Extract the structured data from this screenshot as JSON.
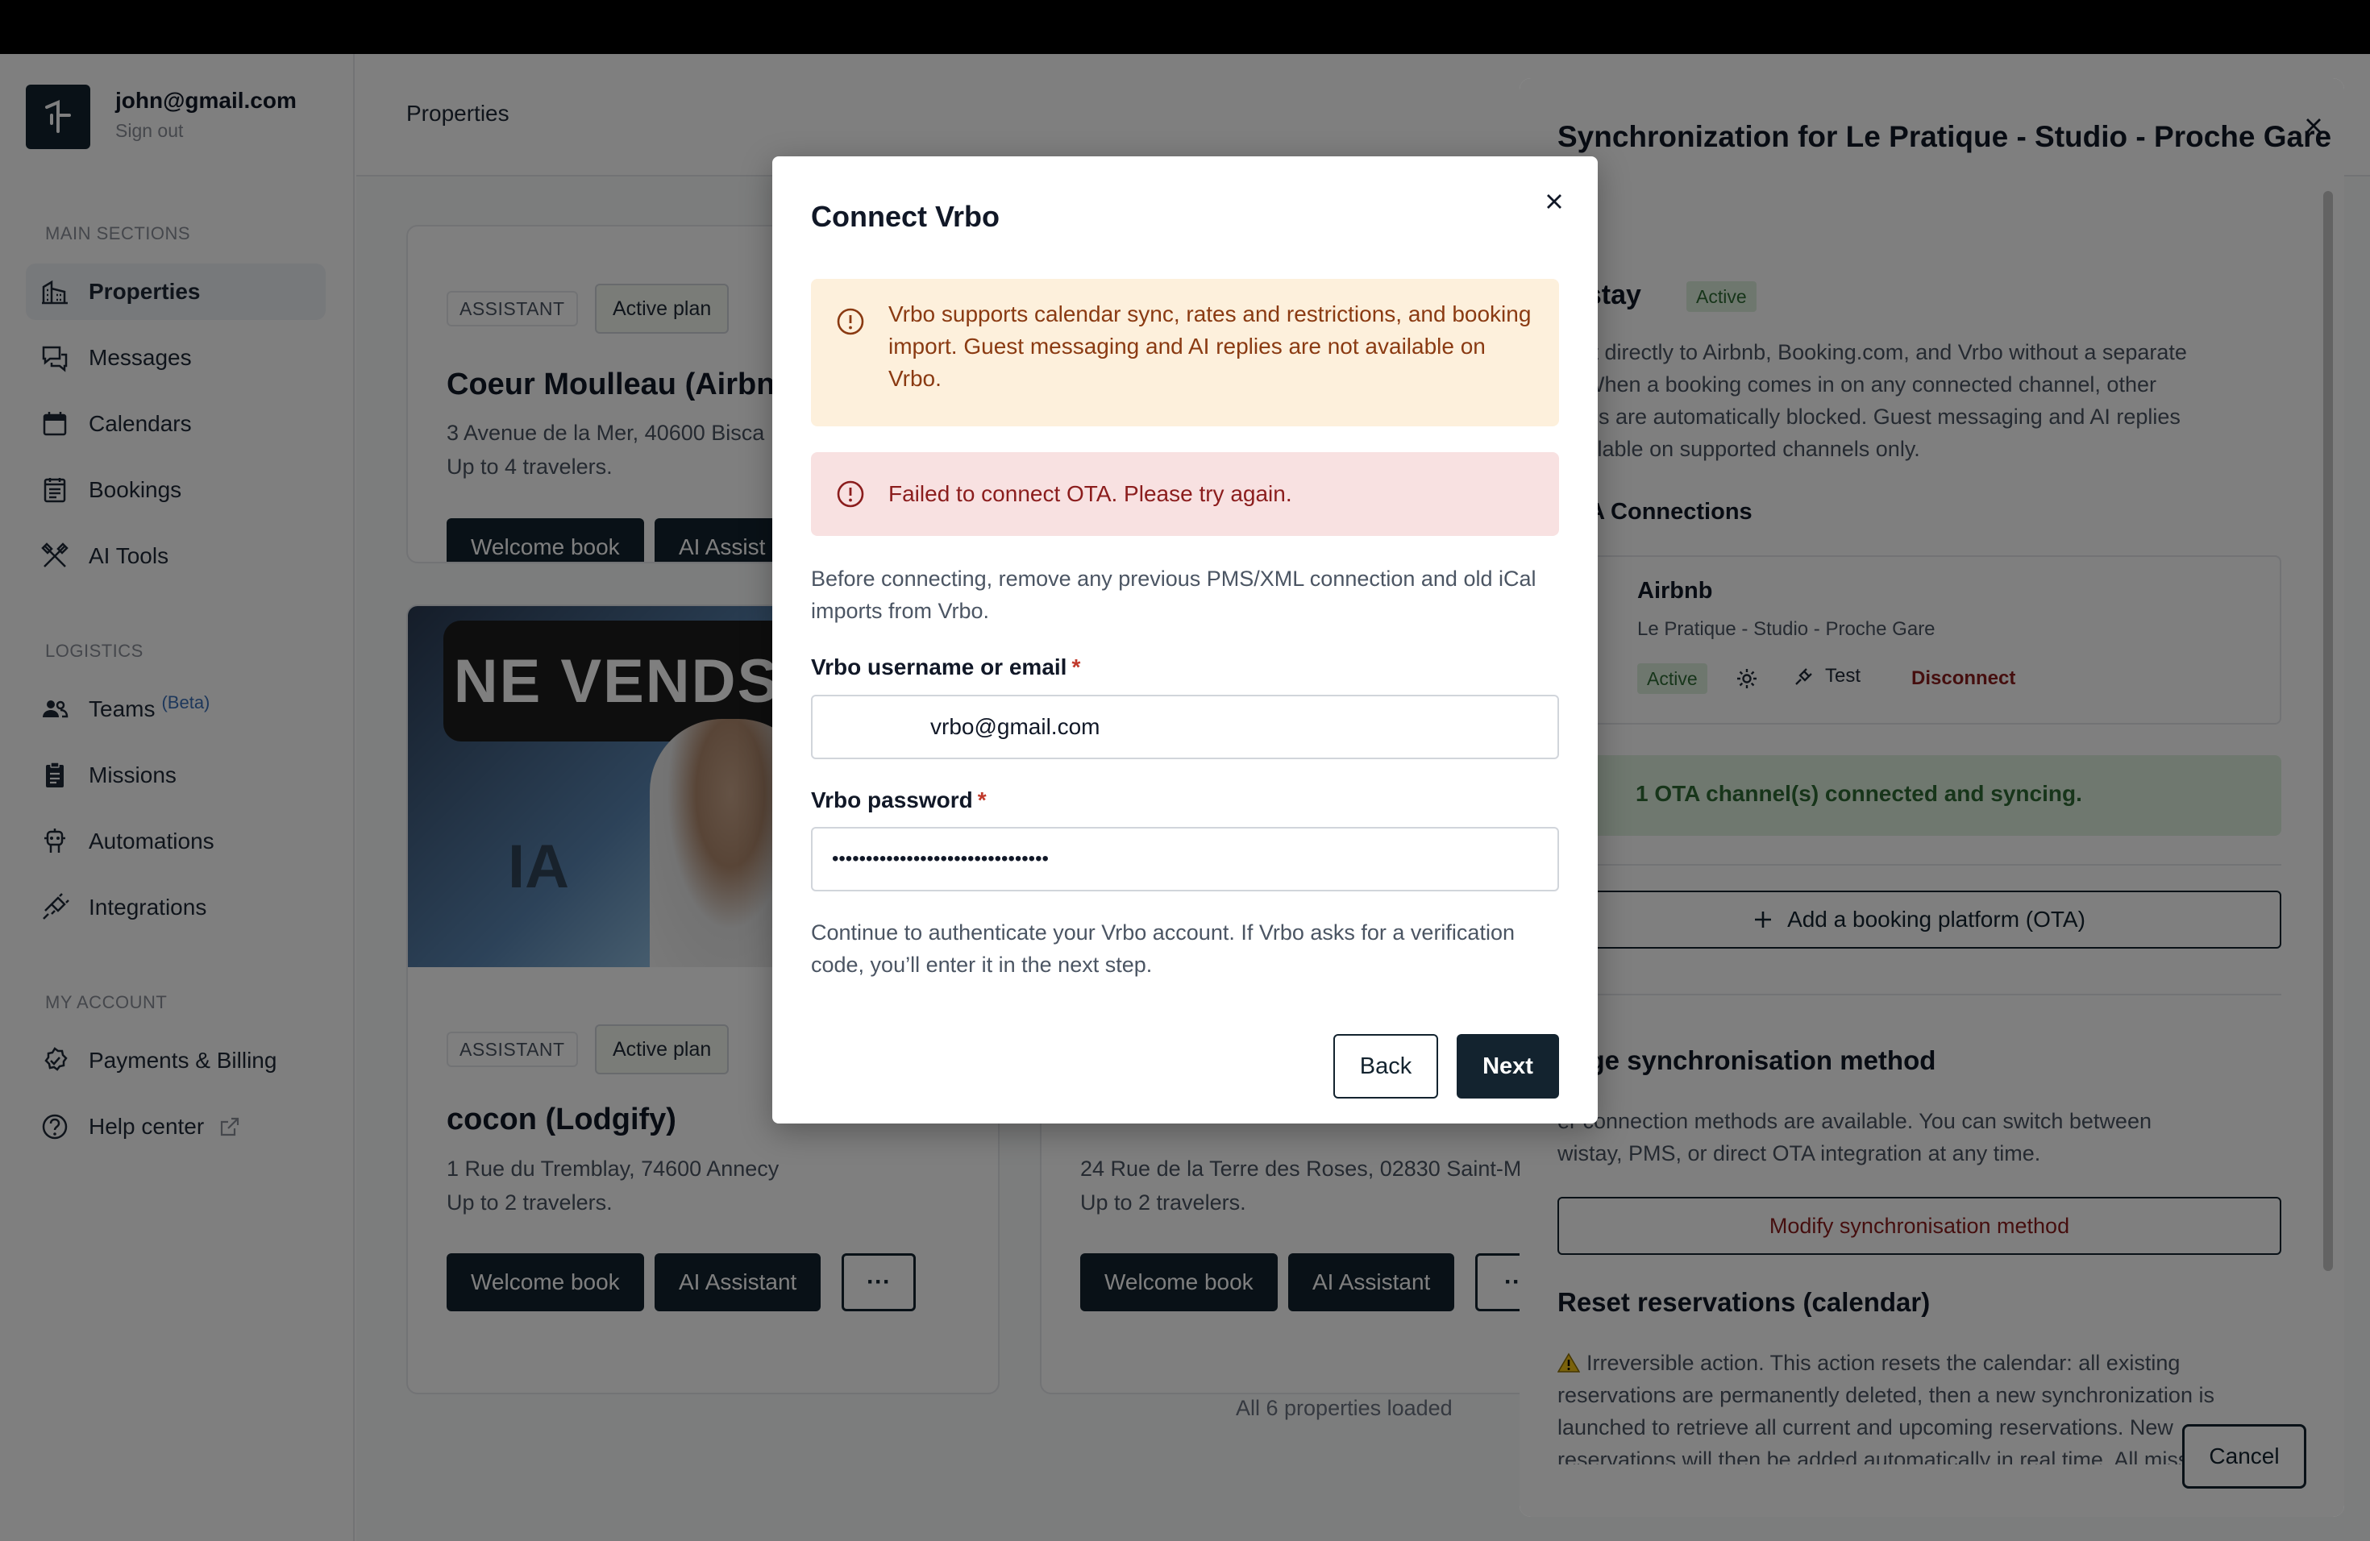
{
  "user": {
    "email": "john@gmail.com",
    "signout": "Sign out"
  },
  "sidebar": {
    "main_label": "MAIN SECTIONS",
    "main_items": [
      {
        "label": "Properties",
        "icon": "properties-icon"
      },
      {
        "label": "Messages",
        "icon": "messages-icon"
      },
      {
        "label": "Calendars",
        "icon": "calendar-icon"
      },
      {
        "label": "Bookings",
        "icon": "bookings-icon"
      },
      {
        "label": "AI Tools",
        "icon": "ai-tools-icon"
      }
    ],
    "logistics_label": "LOGISTICS",
    "logistics_items": [
      {
        "label": "Teams",
        "badge": "(Beta)",
        "icon": "teams-icon"
      },
      {
        "label": "Missions",
        "icon": "missions-icon"
      },
      {
        "label": "Automations",
        "icon": "automations-icon"
      },
      {
        "label": "Integrations",
        "icon": "integrations-icon"
      }
    ],
    "account_label": "MY ACCOUNT",
    "account_items": [
      {
        "label": "Payments & Billing",
        "icon": "billing-icon"
      },
      {
        "label": "Help center",
        "icon": "help-icon"
      }
    ]
  },
  "main": {
    "title": "Properties",
    "cards": [
      {
        "badge_type": "ASSISTANT",
        "badge_plan": "Active plan",
        "title": "Coeur Moulleau (Airbnb",
        "address": "3 Avenue de la Mer, 40600 Bisca",
        "travelers": "Up to 4 travelers.",
        "btn_welcome": "Welcome book",
        "btn_ai": "AI Assist"
      },
      {
        "image_banner": "NE VENDS",
        "image_overlay": "IA",
        "badge_type": "ASSISTANT",
        "badge_plan": "Active plan",
        "title": "cocon (Lodgify)",
        "address": "1 Rue du Tremblay, 74600 Annecy",
        "travelers": "Up to 2 travelers.",
        "btn_welcome": "Welcome book",
        "btn_ai": "AI Assistant",
        "btn_more": "···"
      },
      {
        "address": "24 Rue de la Terre des Roses, 02830 Saint-M",
        "travelers": "Up to 2 travelers.",
        "btn_welcome": "Welcome book",
        "btn_ai": "AI Assistant",
        "btn_more": "··"
      }
    ],
    "loaded_text": "All 6 properties loaded"
  },
  "drawer": {
    "title": "Synchronization for Le Pratique - Studio - Proche Gare",
    "provider_name": "wistay",
    "provider_status": "Active",
    "description_lines": [
      "nect directly to Airbnb, Booking.com, and Vrbo without a separate",
      "S. When a booking comes in on any connected channel, other",
      "nnels are automatically blocked. Guest messaging and AI replies",
      "available on supported channels only."
    ],
    "ota_heading": "OTA Connections",
    "ota": {
      "name": "Airbnb",
      "listing": "Le Pratique - Studio - Proche Gare",
      "status": "Active",
      "test": "Test",
      "disconnect": "Disconnect"
    },
    "success_text": "1 OTA channel(s) connected and syncing.",
    "add_platform": "Add a booking platform (OTA)",
    "change_heading": "ange synchronisation method",
    "change_lines": [
      "er connection methods are available. You can switch between",
      "wistay, PMS, or direct OTA integration at any time."
    ],
    "modify_btn": "Modify synchronisation method",
    "reset_heading": "Reset reservations (calendar)",
    "reset_lines": [
      "Irreversible action. This action resets the calendar: all existing",
      "reservations are permanently deleted, then a new synchronization is",
      "launched to retrieve all current and upcoming reservations. New",
      "reservations will then be added automatically in real time. All missions"
    ],
    "cancel": "Cancel"
  },
  "modal": {
    "title": "Connect Vrbo",
    "warning": "Vrbo supports calendar sync, rates and restrictions, and booking import. Guest messaging and AI replies are not available on Vrbo.",
    "error": "Failed to connect OTA. Please try again.",
    "intro": "Before connecting, remove any previous PMS/XML connection and old iCal imports from Vrbo.",
    "username_label": "Vrbo username or email",
    "username_value": "vrbo@gmail.com",
    "password_label": "Vrbo password",
    "password_value": "••••••••••••••••••••••••••••••••",
    "required_mark": "*",
    "note": "Continue to authenticate your Vrbo account. If Vrbo asks for a verification code, you’ll enter it in the next step.",
    "back": "Back",
    "next": "Next"
  },
  "colors": {
    "primary": "#13232f",
    "warning_bg": "#fdf0dc",
    "error_bg": "#f8e1e1",
    "success_bg": "#dff0df",
    "danger_text": "#8b1d1d"
  }
}
